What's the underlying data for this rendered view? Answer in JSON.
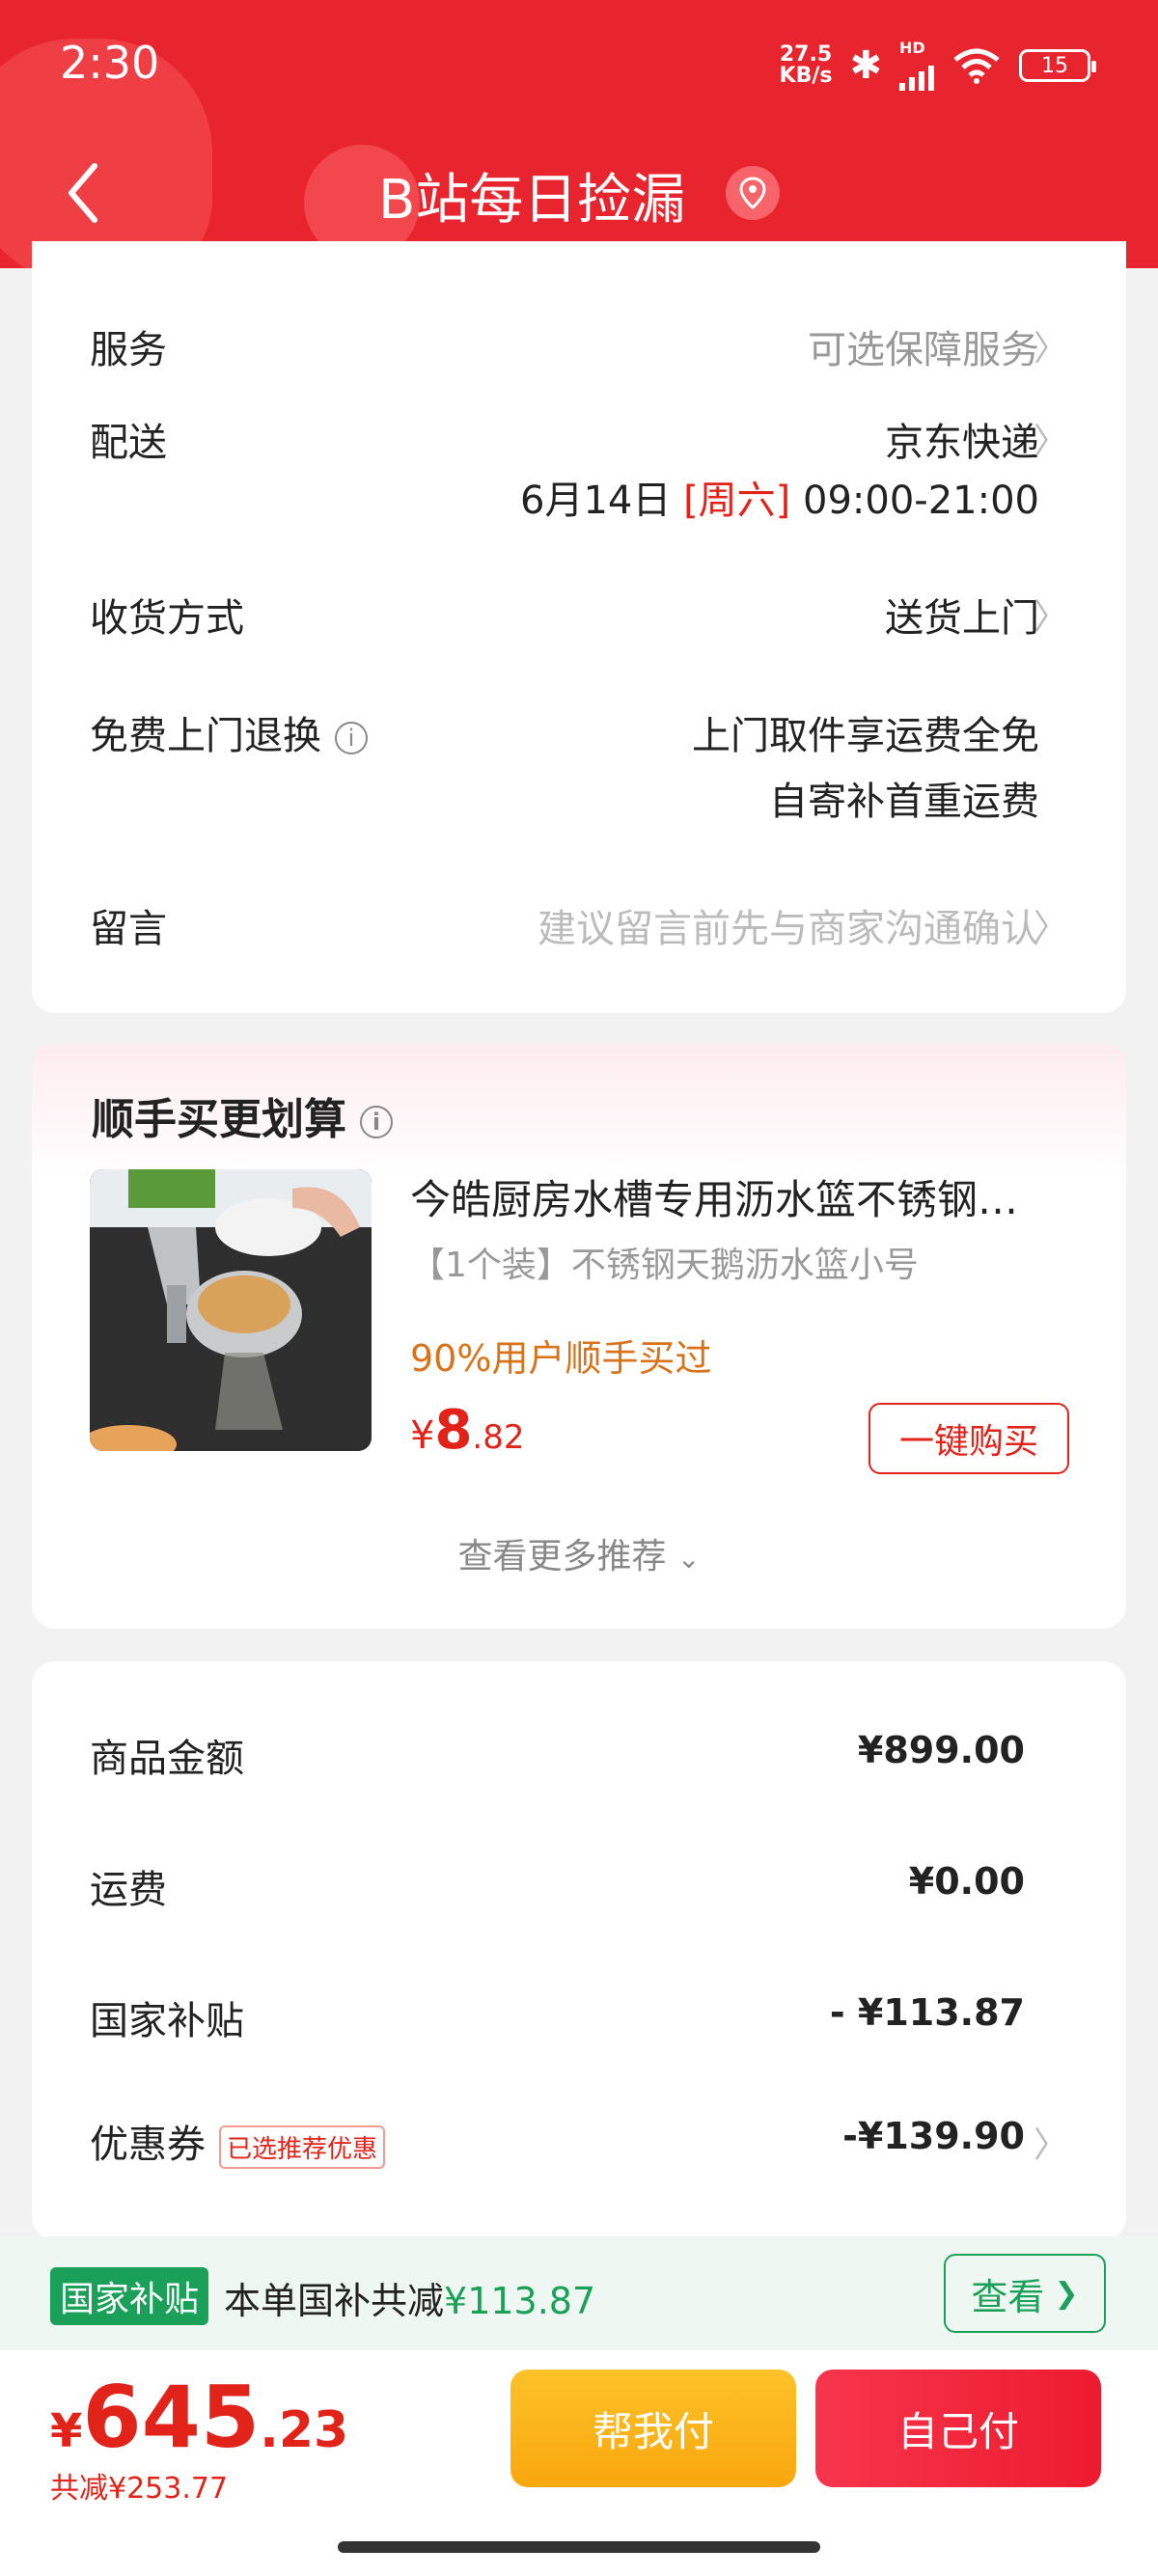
{
  "status_bar": {
    "time": "2:30",
    "net_speed_value": "27.5",
    "net_speed_unit": "KB/s",
    "battery": "15",
    "network_label": "HD"
  },
  "nav": {
    "title": "B站每日捡漏"
  },
  "shipping": {
    "service": {
      "label": "服务",
      "value": "可选保障服务"
    },
    "delivery": {
      "label": "配送",
      "carrier": "京东快递",
      "date": "6月14日",
      "weekday": "[周六]",
      "time_range": "09:00-21:00"
    },
    "receive_method": {
      "label": "收货方式",
      "value": "送货上门"
    },
    "free_return": {
      "label": "免费上门退换",
      "line1": "上门取件享运费全免",
      "line2": "自寄补首重运费"
    },
    "message": {
      "label": "留言",
      "placeholder": "建议留言前先与商家沟通确认"
    }
  },
  "recommend": {
    "title": "顺手买更划算",
    "product": {
      "title": "今皓厨房水槽专用沥水篮不锈钢…",
      "spec": "【1个装】不锈钢天鹅沥水篮小号",
      "note": "90%用户顺手买过",
      "price_symbol": "¥",
      "price_int": "8",
      "price_dec": ".82",
      "buy_label": "一键购买"
    },
    "more_label": "查看更多推荐"
  },
  "summary": {
    "goods": {
      "label": "商品金额",
      "value": "¥899.00"
    },
    "freight": {
      "label": "运费",
      "value": "¥0.00"
    },
    "subsidy": {
      "label": "国家补贴",
      "value": "- ¥113.87"
    },
    "coupon": {
      "label": "优惠券",
      "tag": "已选推荐优惠",
      "value": "-¥139.90"
    }
  },
  "subsidy_bar": {
    "badge": "国家补贴",
    "text": "本单国补共减",
    "amount": "¥113.87",
    "button": "查看"
  },
  "bottom": {
    "currency": "¥",
    "total_int": "645",
    "total_dec": ".23",
    "saved": "共减¥253.77",
    "help_pay": "帮我付",
    "self_pay": "自己付"
  },
  "colors": {
    "brand_red": "#e8242e",
    "price_red": "#e2231a",
    "subsidy_green": "#1aa058",
    "note_orange": "#d9731a"
  }
}
